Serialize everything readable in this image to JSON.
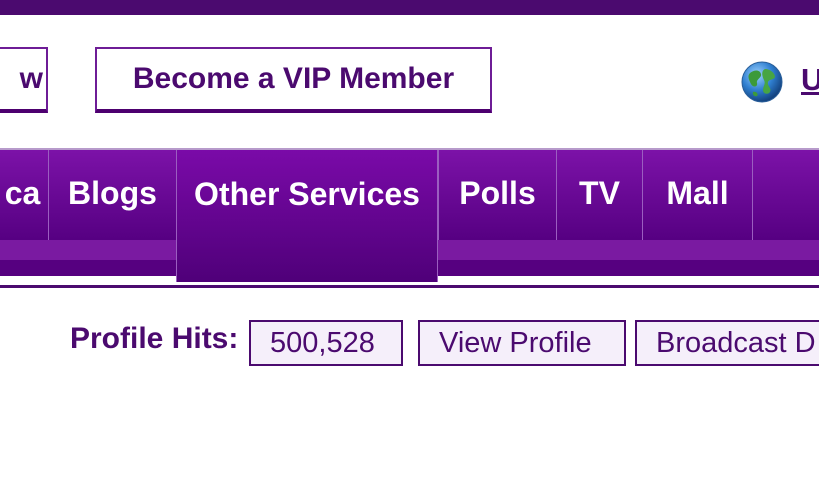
{
  "header": {
    "partial_button_label": "w",
    "vip_button_label": "Become a VIP Member",
    "globe_icon": "globe-icon",
    "partial_link_text": "U"
  },
  "nav": {
    "tabs": [
      {
        "label": "ca"
      },
      {
        "label": "Blogs"
      },
      {
        "label": "Other Services",
        "selected": true
      },
      {
        "label": "Polls"
      },
      {
        "label": "TV"
      },
      {
        "label": "Mall"
      },
      {
        "label": ""
      }
    ]
  },
  "profile": {
    "hits_label": "Profile Hits:",
    "hits_value": "500,528",
    "view_profile_label": "View Profile",
    "broadcast_label": "Broadcast D"
  },
  "colors": {
    "brand_purple": "#4b0a6f",
    "tab_purple": "#6e0aa0",
    "button_background": "#ffffff",
    "box_background": "#f5effa"
  }
}
